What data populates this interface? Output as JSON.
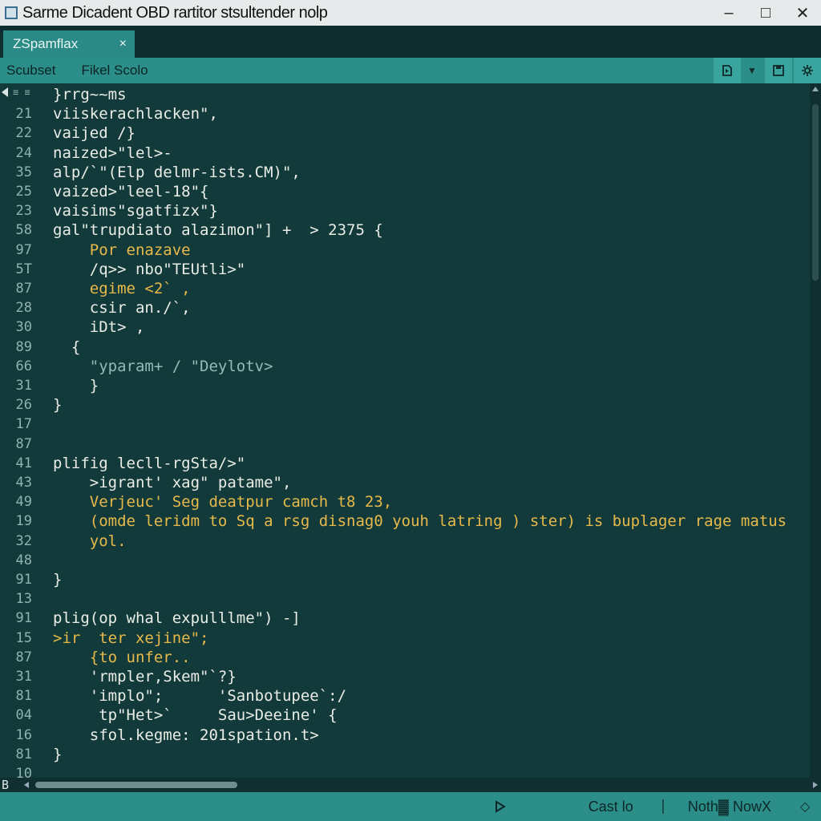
{
  "window": {
    "title": "Sarme Dicadent OBD rartitor stsultender nolp",
    "minimize": "–",
    "maximize": "□",
    "close": "✕"
  },
  "tabs": [
    {
      "label": "ZSpamflax",
      "close": "×"
    }
  ],
  "toolbar": {
    "menu1": "Scubset",
    "menu2": "Fikel Scolo"
  },
  "editor": {
    "gutter_marker": "≡ ≡",
    "lines": [
      {
        "num": "",
        "text": "}rrg~~ms",
        "color": "w"
      },
      {
        "num": "21",
        "text": "viiskerachlacken\",",
        "color": "w"
      },
      {
        "num": "22",
        "text": "vaijed /}",
        "color": "w"
      },
      {
        "num": "24",
        "text": "naized>\"lel>-",
        "color": "w"
      },
      {
        "num": "35",
        "text": "alp/`\"(Elp delmr-ists.CM)\",",
        "color": "w"
      },
      {
        "num": "25",
        "text": "vaized>\"leel-18\"{",
        "color": "w"
      },
      {
        "num": "23",
        "text": "vaisims\"sgatfizx\"}",
        "color": "w"
      },
      {
        "num": "58",
        "text": "gal\"trupdiato alazimon\"] +  > 2375 {",
        "color": "w"
      },
      {
        "num": "97",
        "text": "    Por enazave",
        "color": "y"
      },
      {
        "num": "5T",
        "text": "    /q>> nbo\"TEUtli>\"",
        "color": "w"
      },
      {
        "num": "87",
        "text": "    egime <2` ,",
        "color": "y"
      },
      {
        "num": "28",
        "text": "    csir an./`,",
        "color": "w"
      },
      {
        "num": "30",
        "text": "    iDt> ,",
        "color": "w"
      },
      {
        "num": "89",
        "text": "  {",
        "color": "w"
      },
      {
        "num": "66",
        "text": "    \"yparam+ / \"Deylotv>",
        "color": "g"
      },
      {
        "num": "31",
        "text": "    }",
        "color": "w"
      },
      {
        "num": "26",
        "text": "}",
        "color": "w"
      },
      {
        "num": "17",
        "text": "",
        "color": "w"
      },
      {
        "num": "87",
        "text": "",
        "color": "w"
      },
      {
        "num": "41",
        "text": "plifig lecll-rgSta/>\"",
        "color": "w"
      },
      {
        "num": "43",
        "text": "    >igrant' xag\" patame\",",
        "color": "w"
      },
      {
        "num": "49",
        "text": "    Verjeuc' Seg deatpur camch t8 23,",
        "color": "y"
      },
      {
        "num": "19",
        "text": "    (omde leridm to Sq a rsg disnag0 youh latring ) ster) is buplager rage matus",
        "color": "y"
      },
      {
        "num": "32",
        "text": "    yol.",
        "color": "y"
      },
      {
        "num": "48",
        "text": "",
        "color": "w"
      },
      {
        "num": "91",
        "text": "}",
        "color": "w"
      },
      {
        "num": "13",
        "text": "",
        "color": "w"
      },
      {
        "num": "91",
        "text": "plig(op whal expulllme\") -]",
        "color": "w"
      },
      {
        "num": "15",
        "text": ">ir  ter xejine\";",
        "color": "y"
      },
      {
        "num": "87",
        "text": "    {to unfer..",
        "color": "y"
      },
      {
        "num": "31",
        "text": "    'rmpler,Skem\"`?}",
        "color": "w"
      },
      {
        "num": "81",
        "text": "    'implo\";      'Sanbotupee`:/",
        "color": "w"
      },
      {
        "num": "04",
        "text": "     tp\"Het>`     Sau>Deeine' {",
        "color": "w"
      },
      {
        "num": "16",
        "text": "    sfol.kegme: 201spation.t>",
        "color": "w"
      },
      {
        "num": "81",
        "text": "}",
        "color": "w"
      },
      {
        "num": "10",
        "text": "",
        "color": "w"
      }
    ]
  },
  "hscroll": {
    "label": "B"
  },
  "statusbar": {
    "item1": "Cast lo",
    "item2": "Noth▓ NowX"
  },
  "colors": {
    "background": "#133a3a",
    "accent": "#2c8e88",
    "keyword_yellow": "#e7b94a",
    "text": "#e9ede6"
  }
}
